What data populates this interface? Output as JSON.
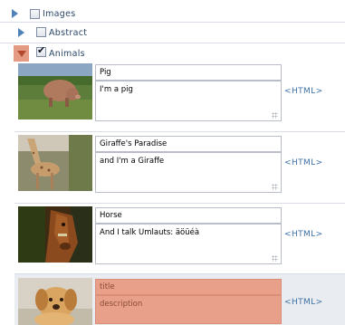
{
  "tree": {
    "images": {
      "label": "Images",
      "checked": false,
      "expanded": false
    },
    "abstract": {
      "label": "Abstract",
      "checked": false,
      "expanded": false
    },
    "animals": {
      "label": "Animals",
      "checked": true,
      "expanded": true
    }
  },
  "items": [
    {
      "title": "Pig",
      "description": "I'm a pig",
      "thumb": "pig-photo",
      "html_link": "<HTML>"
    },
    {
      "title": "Giraffe's Paradise",
      "description": "and I'm a Giraffe",
      "thumb": "giraffe-photo",
      "html_link": "<HTML>"
    },
    {
      "title": "Horse",
      "description": "And I talk Umlauts: äöüéà",
      "thumb": "horse-photo",
      "html_link": "<HTML>"
    }
  ],
  "new_item": {
    "title_placeholder": "title",
    "description_placeholder": "description",
    "thumb": "puppy-photo",
    "html_link": "<HTML>"
  },
  "colors": {
    "link": "#3d70a5",
    "highlight": "#e8a08a",
    "expander": "#4f83b7"
  }
}
